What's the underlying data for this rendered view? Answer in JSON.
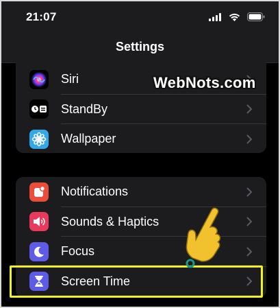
{
  "status_bar": {
    "time": "21:07"
  },
  "nav": {
    "title": "Settings"
  },
  "group1": {
    "items": [
      {
        "label": "Siri",
        "icon": "siri-icon"
      },
      {
        "label": "StandBy",
        "icon": "standby-icon"
      },
      {
        "label": "Wallpaper",
        "icon": "wallpaper-icon"
      }
    ]
  },
  "group2": {
    "items": [
      {
        "label": "Notifications",
        "icon": "notifications-icon",
        "color": "#eb4d3d"
      },
      {
        "label": "Sounds & Haptics",
        "icon": "speaker-icon",
        "color": "#e83a5c"
      },
      {
        "label": "Focus",
        "icon": "moon-icon",
        "color": "#5e5ce6"
      },
      {
        "label": "Screen Time",
        "icon": "hourglass-icon",
        "color": "#5e5ce6"
      }
    ]
  },
  "colors": {
    "background": "#000000",
    "group_background": "#1c1c1e",
    "highlight": "#f2f21c",
    "pointer": "#f2c12e"
  },
  "watermark": "WebNots.com"
}
